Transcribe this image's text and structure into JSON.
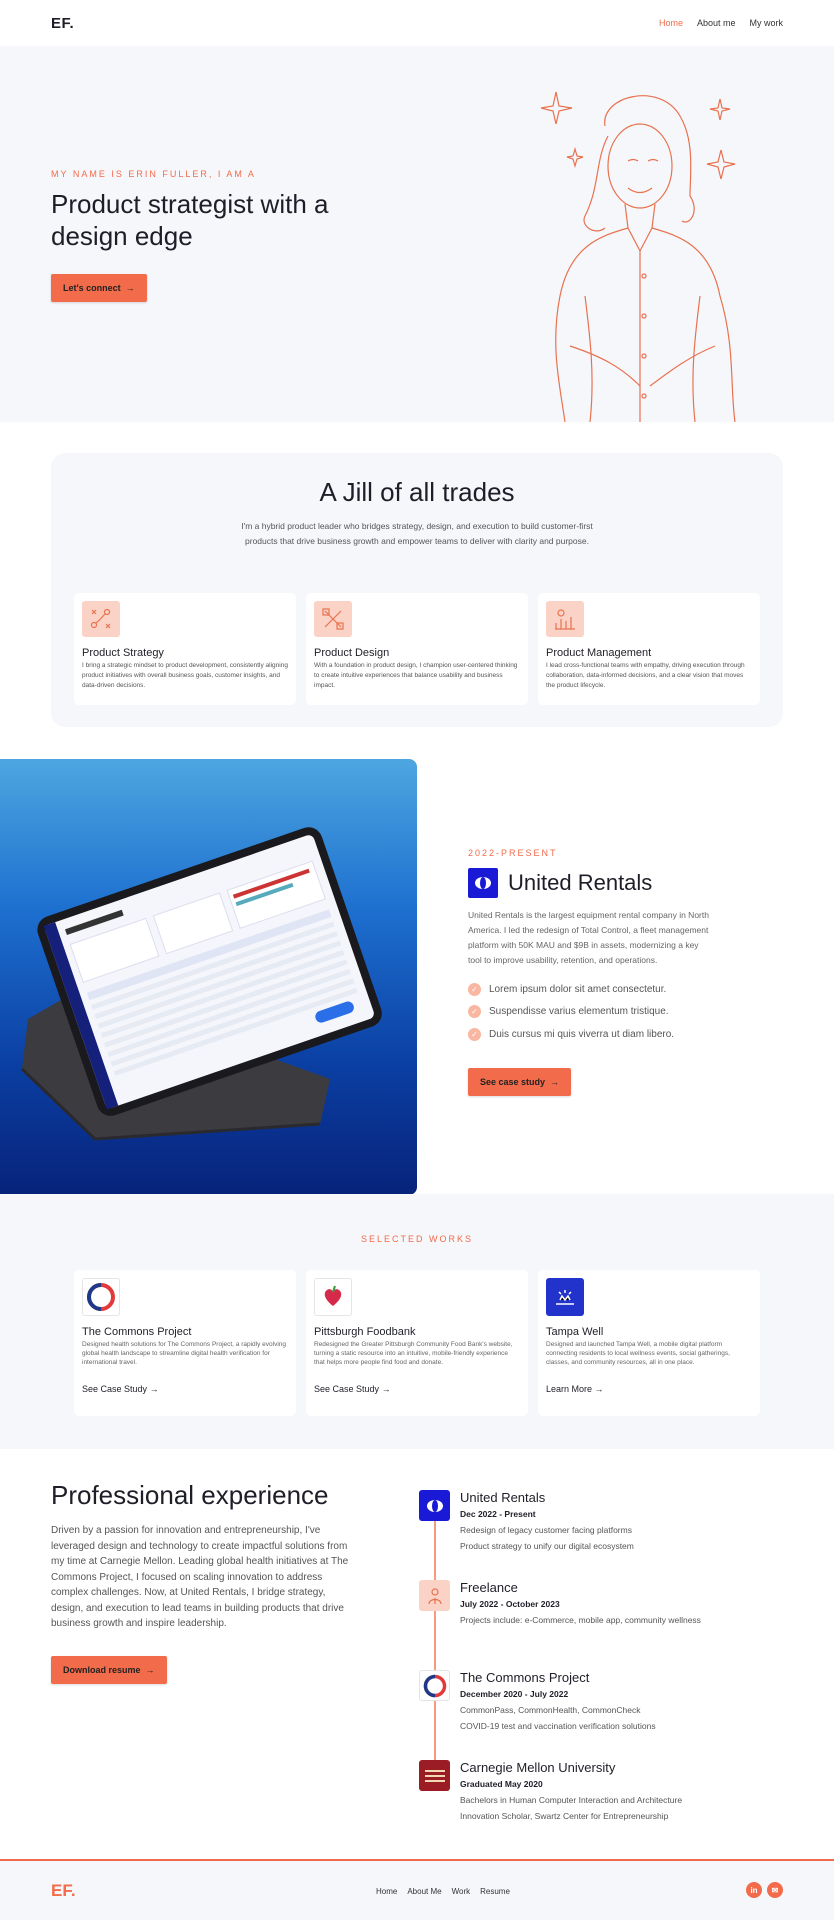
{
  "header": {
    "logo": "EF.",
    "nav": [
      "Home",
      "About me",
      "My work"
    ]
  },
  "hero": {
    "kicker": "MY NAME IS ERIN FULLER, I AM A",
    "title": "Product strategist with a design edge",
    "cta": "Let's connect"
  },
  "trades": {
    "title": "A Jill of all trades",
    "lead": "I'm a hybrid product leader who bridges strategy, design, and execution to build customer-first products that drive business growth and empower teams to deliver with clarity and purpose.",
    "cards": [
      {
        "title": "Product Strategy",
        "text": "I bring a strategic mindset to product development, consistently aligning product initiatives with overall business goals, customer insights, and data-driven decisions.",
        "icon": "strategy-icon"
      },
      {
        "title": "Product Design",
        "text": "With a foundation in product design, I champion user-centered thinking to create intuitive experiences that balance usability and business impact.",
        "icon": "design-icon"
      },
      {
        "title": "Product Management",
        "text": "I lead cross-functional teams with empathy, driving execution through collaboration, data-informed decisions, and a clear vision that moves the product lifecycle.",
        "icon": "management-icon"
      }
    ]
  },
  "united": {
    "kicker": "2022-PRESENT",
    "title": "United Rentals",
    "desc": "United Rentals is the largest equipment rental company in North America. I led the redesign of Total Control, a fleet management platform with 50K MAU and $9B in assets, modernizing a key tool to improve usability, retention, and operations.",
    "bullets": [
      "Lorem ipsum dolor sit amet consectetur.",
      "Suspendisse varius elementum tristique.",
      "Duis cursus mi quis viverra ut diam libero."
    ],
    "cta": "See case study"
  },
  "works": {
    "kicker": "SELECTED WORKS",
    "items": [
      {
        "title": "The Commons Project",
        "text": "Designed health solutions for The Commons Project, a rapidly evolving global health landscape to streamline digital health verification for international travel.",
        "link": "See Case Study"
      },
      {
        "title": "Pittsburgh Foodbank",
        "text": "Redesigned the Greater Pittsburgh Community Food Bank's website, turning a static resource into an intuitive, mobile-friendly experience that helps more people find food and donate.",
        "link": "See Case Study"
      },
      {
        "title": "Tampa Well",
        "text": "Designed and launched Tampa Well, a mobile digital platform connecting residents to local wellness events, social gatherings, classes, and community resources, all in one place.",
        "link": "Learn More"
      }
    ]
  },
  "experience": {
    "title": "Professional experience",
    "text": "Driven by a passion for innovation and entrepreneurship, I've leveraged design and technology to create impactful solutions from my time at Carnegie Mellon. Leading global health initiatives at The Commons Project, I focused on scaling innovation to address complex challenges. Now, at United Rentals, I bridge strategy, design, and execution to lead teams in building products that drive business growth and inspire leadership.",
    "cta": "Download resume",
    "timeline": [
      {
        "name": "United Rentals",
        "date": "Dec 2022 - Present",
        "lines": [
          "Redesign of legacy customer facing platforms",
          "Product strategy to unify our digital ecosystem"
        ]
      },
      {
        "name": "Freelance",
        "date": "July 2022 - October 2023",
        "lines": [
          "Projects include: e-Commerce, mobile app, community wellness"
        ]
      },
      {
        "name": "The Commons Project",
        "date": "December 2020 - July 2022",
        "lines": [
          "CommonPass, CommonHealth, CommonCheck",
          "COVID-19 test and vaccination verification solutions"
        ]
      },
      {
        "name": "Carnegie Mellon University",
        "date": "Graduated May 2020",
        "lines": [
          "Bachelors in Human Computer Interaction and Architecture",
          "Innovation Scholar, Swartz Center for Entrepreneurship"
        ]
      }
    ]
  },
  "footer": {
    "logo": "EF.",
    "nav": [
      "Home",
      "About Me",
      "Work",
      "Resume"
    ],
    "social": [
      "in",
      "✉"
    ]
  },
  "colors": {
    "accent": "#f26b4a",
    "bg_soft": "#f6f7fb",
    "ur_blue": "#1a1ad6"
  }
}
